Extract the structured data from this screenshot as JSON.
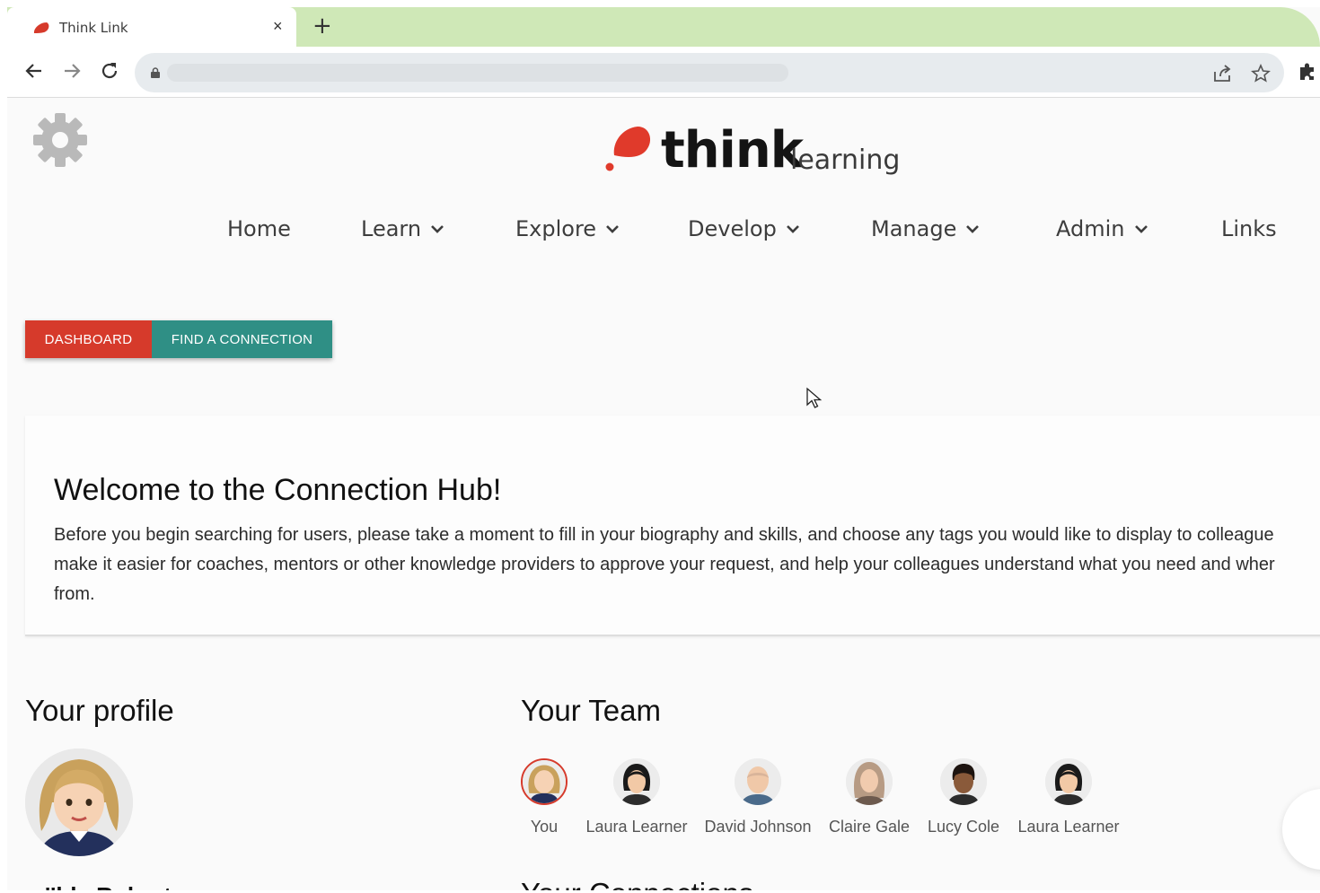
{
  "browser": {
    "tab_title": "Think Link",
    "tab_close": "×",
    "new_tab": "+"
  },
  "logo": {
    "word": "think",
    "sub": "learning"
  },
  "nav": {
    "home": "Home",
    "learn": "Learn",
    "explore": "Explore",
    "develop": "Develop",
    "manage": "Manage",
    "admin": "Admin",
    "links": "Links"
  },
  "buttons": {
    "dashboard": "DASHBOARD",
    "find_connection": "FIND A CONNECTION"
  },
  "welcome": {
    "title": "Welcome to the Connection Hub!",
    "line1": "Before you begin searching for users, please take a moment to fill in your biography and skills, and choose any tags you would like to display to colleague",
    "line2": "make it easier for coaches, mentors or other knowledge providers to approve your request, and help your colleagues understand what you need and wher",
    "line3": "from."
  },
  "profile": {
    "heading": "Your profile",
    "name": "''lda Roberts"
  },
  "team": {
    "heading": "Your Team",
    "members": [
      {
        "name": "You"
      },
      {
        "name": "Laura Learner"
      },
      {
        "name": "David Johnson"
      },
      {
        "name": "Claire Gale"
      },
      {
        "name": "Lucy Cole"
      },
      {
        "name": "Laura Learner"
      }
    ]
  },
  "connections": {
    "heading": "Your Connections"
  },
  "colors": {
    "brand_red": "#d63a2b",
    "teal": "#2f8f85",
    "tab_green": "#cfe8b7"
  }
}
